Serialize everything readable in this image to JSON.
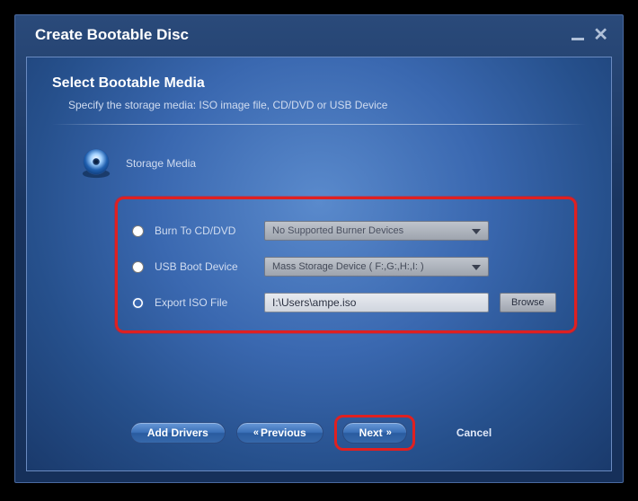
{
  "window": {
    "title": "Create Bootable Disc"
  },
  "page": {
    "heading": "Select Bootable Media",
    "subheading": "Specify the storage media: ISO image file, CD/DVD or USB Device",
    "section_label": "Storage Media"
  },
  "options": {
    "cd_dvd": {
      "label": "Burn To CD/DVD",
      "dropdown": "No Supported Burner Devices",
      "selected": false
    },
    "usb": {
      "label": "USB Boot Device",
      "dropdown": "Mass Storage Device  ( F:,G:,H:,I: )",
      "selected": false
    },
    "iso": {
      "label": "Export ISO File",
      "path": "I:\\Users\\ampe.iso",
      "browse_label": "Browse",
      "selected": true
    }
  },
  "buttons": {
    "add_drivers": "Add Drivers",
    "previous": "Previous",
    "next": "Next",
    "cancel": "Cancel"
  }
}
